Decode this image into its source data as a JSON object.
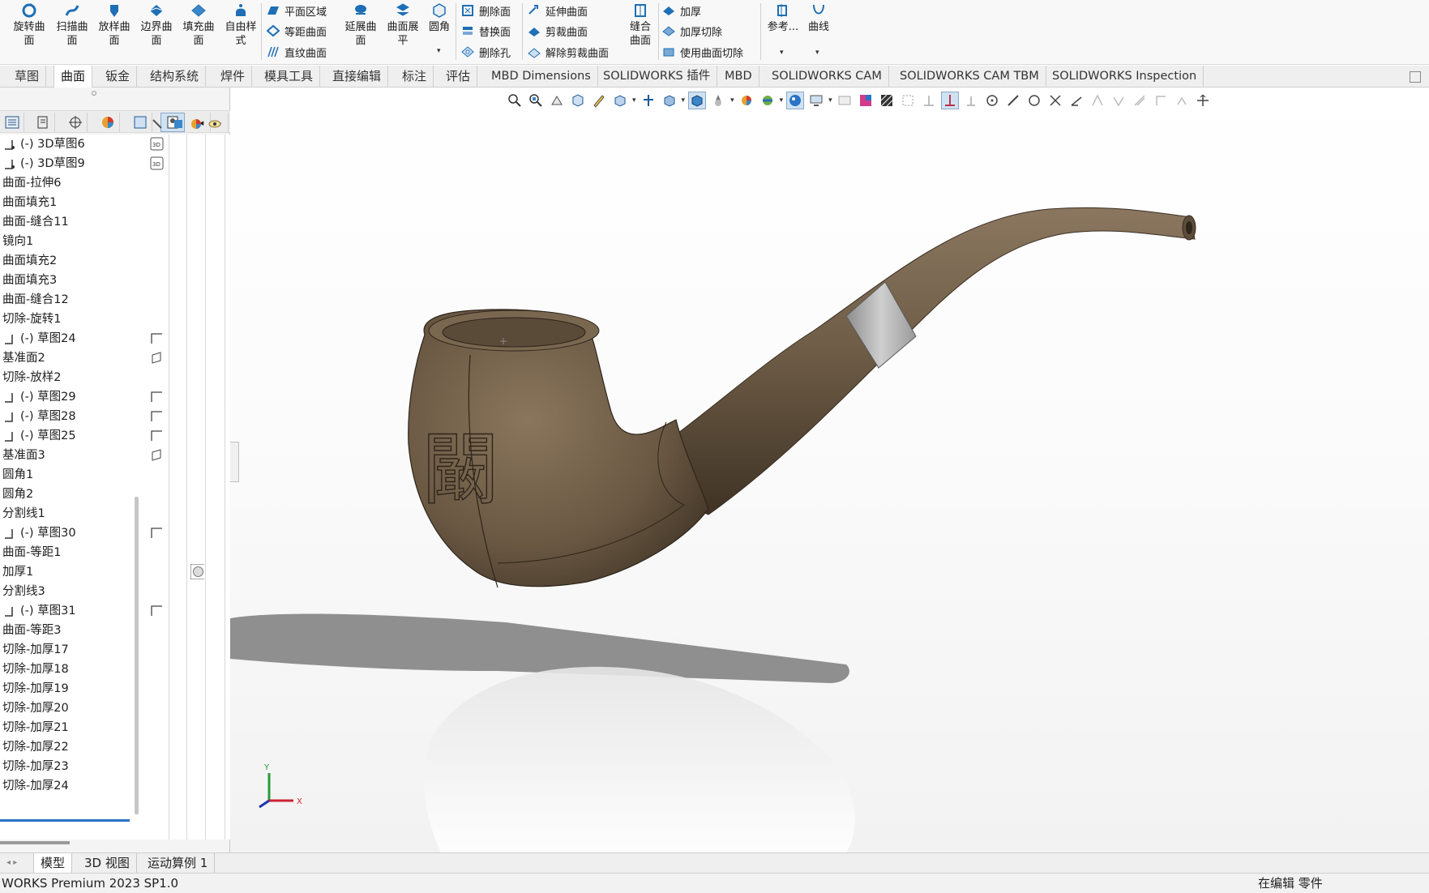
{
  "ribbon": {
    "large_buttons": [
      {
        "label": "旋转曲\n面",
        "icon": "revolve-surface-icon"
      },
      {
        "label": "扫描曲\n面",
        "icon": "sweep-surface-icon"
      },
      {
        "label": "放样曲\n面",
        "icon": "loft-surface-icon"
      },
      {
        "label": "边界曲\n面",
        "icon": "boundary-surface-icon"
      },
      {
        "label": "填充曲\n面",
        "icon": "fill-surface-icon"
      },
      {
        "label": "自由样\n式",
        "icon": "freeform-icon"
      },
      {
        "label": "延展曲\n面",
        "icon": "extend-surface-icon"
      },
      {
        "label": "曲面展\n平",
        "icon": "flatten-surface-icon"
      },
      {
        "label": "圆角",
        "icon": "fillet-icon"
      },
      {
        "label": "缝合\n曲面",
        "icon": "knit-surface-icon"
      },
      {
        "label": "参考...",
        "icon": "reference-geometry-icon"
      },
      {
        "label": "曲线",
        "icon": "curves-icon"
      }
    ],
    "small_buttons": [
      {
        "label": "平面区域",
        "icon": "planar-surface-icon"
      },
      {
        "label": "等距曲面",
        "icon": "offset-surface-icon"
      },
      {
        "label": "直纹曲面",
        "icon": "ruled-surface-icon"
      },
      {
        "label": "删除面",
        "icon": "delete-face-icon"
      },
      {
        "label": "替换面",
        "icon": "replace-face-icon"
      },
      {
        "label": "删除孔",
        "icon": "delete-hole-icon"
      },
      {
        "label": "延伸曲面",
        "icon": "extend-surface-small-icon"
      },
      {
        "label": "剪裁曲面",
        "icon": "trim-surface-icon"
      },
      {
        "label": "解除剪裁曲面",
        "icon": "untrim-surface-icon"
      },
      {
        "label": "加厚",
        "icon": "thicken-icon"
      },
      {
        "label": "加厚切除",
        "icon": "thicken-cut-icon"
      },
      {
        "label": "使用曲面切除",
        "icon": "surface-cut-icon"
      }
    ]
  },
  "tabs": [
    {
      "label": "草图"
    },
    {
      "label": "曲面"
    },
    {
      "label": "钣金"
    },
    {
      "label": "结构系统"
    },
    {
      "label": "焊件"
    },
    {
      "label": "模具工具"
    },
    {
      "label": "直接编辑"
    },
    {
      "label": "标注"
    },
    {
      "label": "评估"
    },
    {
      "label": "MBD Dimensions"
    },
    {
      "label": "SOLIDWORKS 插件"
    },
    {
      "label": "MBD"
    },
    {
      "label": "SOLIDWORKS CAM"
    },
    {
      "label": "SOLIDWORKS CAM TBM"
    },
    {
      "label": "SOLIDWORKS Inspection"
    }
  ],
  "active_tab": "曲面",
  "feature_tree": [
    {
      "label": "(-) 3D草图6",
      "icon": "3d-sketch-icon",
      "col": "3D"
    },
    {
      "label": "(-) 3D草图9",
      "icon": "3d-sketch-icon",
      "col": "3D"
    },
    {
      "label": "曲面-拉伸6"
    },
    {
      "label": "曲面填充1"
    },
    {
      "label": "曲面-缝合11"
    },
    {
      "label": "镜向1"
    },
    {
      "label": "曲面填充2"
    },
    {
      "label": "曲面填充3"
    },
    {
      "label": "曲面-缝合12"
    },
    {
      "label": "切除-旋转1"
    },
    {
      "label": "(-) 草图24",
      "icon": "sketch-icon",
      "col": "sketch"
    },
    {
      "label": "基准面2",
      "col": "plane"
    },
    {
      "label": "切除-放样2"
    },
    {
      "label": "(-) 草图29",
      "icon": "sketch-icon",
      "col": "sketch"
    },
    {
      "label": "(-) 草图28",
      "icon": "sketch-icon",
      "col": "sketch"
    },
    {
      "label": "(-) 草图25",
      "icon": "sketch-icon",
      "col": "sketch"
    },
    {
      "label": "基准面3",
      "col": "plane"
    },
    {
      "label": "圆角1"
    },
    {
      "label": "圆角2"
    },
    {
      "label": "分割线1"
    },
    {
      "label": "(-) 草图30",
      "icon": "sketch-icon",
      "col": "sketch"
    },
    {
      "label": "曲面-等距1"
    },
    {
      "label": "加厚1",
      "col": "appearance"
    },
    {
      "label": "分割线3"
    },
    {
      "label": "(-) 草图31",
      "icon": "sketch-icon",
      "col": "sketch"
    },
    {
      "label": "曲面-等距3"
    },
    {
      "label": "切除-加厚17"
    },
    {
      "label": "切除-加厚18"
    },
    {
      "label": "切除-加厚19"
    },
    {
      "label": "切除-加厚20"
    },
    {
      "label": "切除-加厚21"
    },
    {
      "label": "切除-加厚22"
    },
    {
      "label": "切除-加厚23"
    },
    {
      "label": "切除-加厚24"
    }
  ],
  "bottom_tabs": [
    {
      "label": "模型"
    },
    {
      "label": "3D 视图"
    },
    {
      "label": "运动算例 1"
    }
  ],
  "status": {
    "left": "WORKS Premium 2023 SP1.0",
    "right": "在编辑 零件"
  },
  "model": {
    "engraved_char": "闞"
  },
  "triad": {
    "x": "X",
    "y": "Y"
  },
  "colors": {
    "pipe": "#6b5a44",
    "band": "#a8a8a8",
    "accent": "#2a73c6"
  }
}
